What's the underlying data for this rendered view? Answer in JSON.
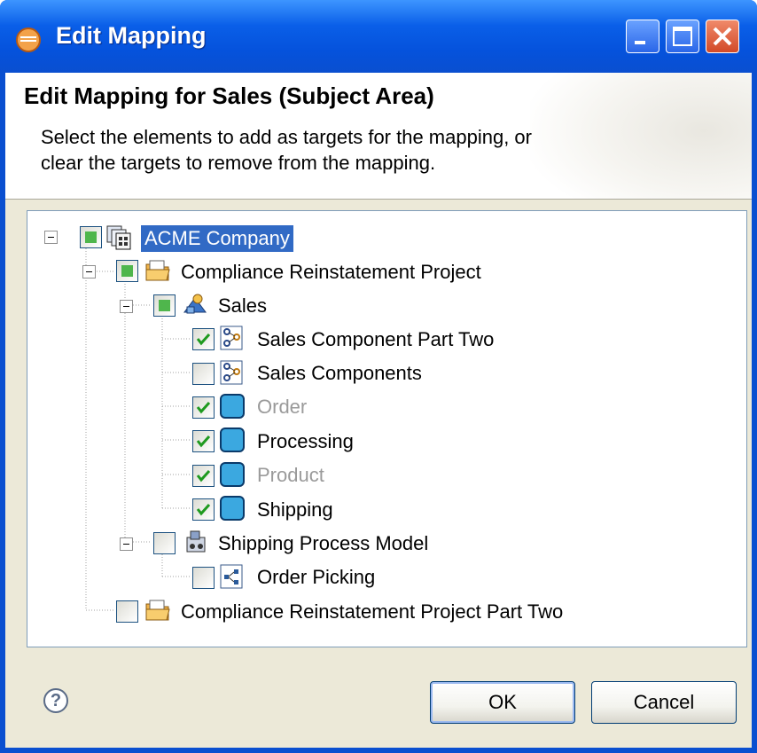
{
  "window": {
    "title": "Edit Mapping",
    "app_icon": "eclipse-app-icon",
    "controls": [
      "minimize",
      "maximize",
      "close"
    ]
  },
  "header": {
    "title": "Edit Mapping for Sales (Subject Area)",
    "description_line1": "Select the elements to add as targets for the mapping, or",
    "description_line2": "clear the targets to remove from the mapping."
  },
  "tree": {
    "nodes": [
      {
        "label": "ACME Company",
        "state": "partial",
        "icon": "company-icon",
        "selected": true
      },
      {
        "label": "Compliance Reinstatement Project",
        "state": "partial",
        "icon": "project-folder-icon"
      },
      {
        "label": "Sales",
        "state": "partial",
        "icon": "subject-area-icon"
      },
      {
        "label": "Sales Component Part Two",
        "state": "checked",
        "icon": "component-icon"
      },
      {
        "label": "Sales Components",
        "state": "unchecked",
        "icon": "component-icon"
      },
      {
        "label": "Order",
        "state": "checked",
        "icon": "entity-icon",
        "disabled": true
      },
      {
        "label": "Processing",
        "state": "checked",
        "icon": "entity-icon"
      },
      {
        "label": "Product",
        "state": "checked",
        "icon": "entity-icon",
        "disabled": true
      },
      {
        "label": "Shipping",
        "state": "checked",
        "icon": "entity-icon"
      },
      {
        "label": "Shipping Process Model",
        "state": "unchecked",
        "icon": "process-model-icon"
      },
      {
        "label": "Order Picking",
        "state": "unchecked",
        "icon": "process-icon"
      },
      {
        "label": "Compliance Reinstatement Project Part Two",
        "state": "unchecked",
        "icon": "project-folder-icon"
      }
    ]
  },
  "footer": {
    "help_symbol": "?",
    "ok_label": "OK",
    "cancel_label": "Cancel"
  },
  "colors": {
    "titlebar": "#0552dc",
    "selection": "#316ac5",
    "check_green": "#4fb64c"
  }
}
